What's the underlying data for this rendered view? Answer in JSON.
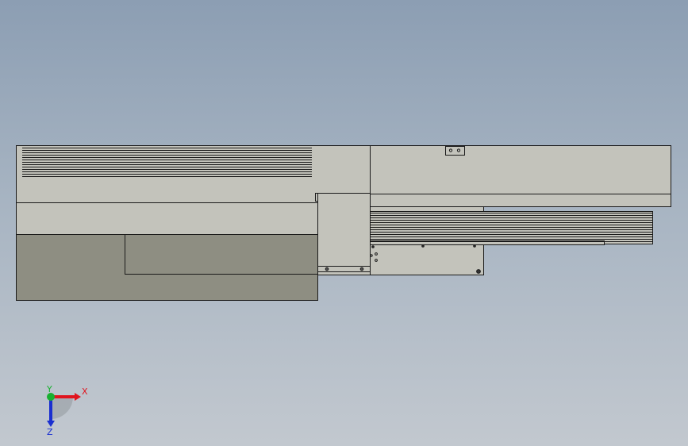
{
  "viewport": {
    "background_top": "#8c9eb3",
    "background_bottom": "#c2c8cf",
    "part_fill_light": "#c3c3bb",
    "part_fill_dark": "#8e8e82",
    "edge_color": "#1a1a1a"
  },
  "triad": {
    "x_label": "X",
    "y_label": "Y",
    "z_label": "Z",
    "x_color": "#e0141e",
    "y_color": "#18b030",
    "z_color": "#1a2fd0"
  }
}
